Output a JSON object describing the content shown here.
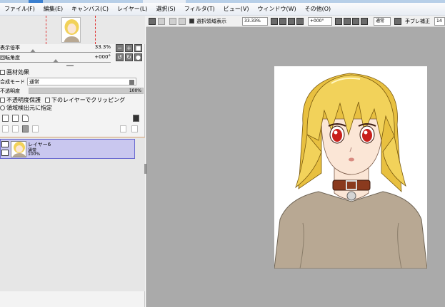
{
  "menu": [
    "ファイル(F)",
    "編集(E)",
    "キャンバス(C)",
    "レイヤー(L)",
    "選択(S)",
    "フィルタ(T)",
    "ビュー(V)",
    "ウィンドウ(W)",
    "その他(O)"
  ],
  "navigator": {
    "zoom_label": "表示倍率",
    "zoom_value": "33.3%",
    "rotation_label": "回転角度",
    "rotation_value": "+000°"
  },
  "texture": {
    "label": "画材効果"
  },
  "layer_props": {
    "blend_label": "合成モード",
    "blend_value": "通常",
    "opacity_label": "不透明度",
    "opacity_value": "100%",
    "opacity_fraction": 1.0,
    "protect_alpha_label": "不透明度保護",
    "clipping_label": "下のレイヤーでクリッピング",
    "selection_source_label": "領域検出元に指定"
  },
  "layers": [
    {
      "name": "レイヤー6",
      "mode": "通常",
      "opacity": "100%"
    }
  ],
  "canvas_toolbar": {
    "show_selection_label": "選択領域表示",
    "zoom_value": "33.33%",
    "rotation_value": "+000°",
    "mode_value": "通常",
    "stabilizer_label": "手ブレ補正",
    "stabilizer_value": "14"
  },
  "colors": {
    "menu_bg": "#eef1f6",
    "canvas_bg": "#aaaaaa",
    "selected_layer": "#c9c7ef",
    "hair": "#f2d25a",
    "eyes": "#c8201c",
    "shirt": "#b8a893",
    "collar": "#8a3a1e"
  }
}
